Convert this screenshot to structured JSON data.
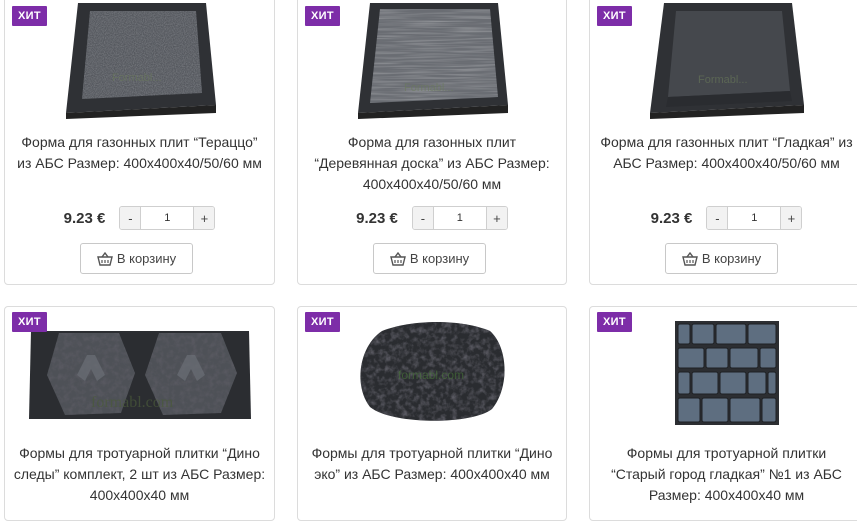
{
  "badge": "ХИТ",
  "cart_label": "В корзину",
  "products": [
    {
      "title": "Форма для газонных плит “Тераццо” из АБС Размер: 400x400x40/50/60 мм",
      "price": "9.23 €",
      "qty": "1",
      "minus": "-",
      "plus": "+",
      "watermark": "Formabl..."
    },
    {
      "title": "Форма для газонных плит “Деревянная доска” из АБС Размер: 400x400x40/50/60 мм",
      "price": "9.23 €",
      "qty": "1",
      "minus": "-",
      "plus": "+",
      "watermark": "Formabl..."
    },
    {
      "title": "Форма для газонных плит “Гладкая” из АБС Размер: 400x400x40/50/60 мм",
      "price": "9.23 €",
      "qty": "1",
      "minus": "-",
      "plus": "+",
      "watermark": "Formabl..."
    },
    {
      "title": "Формы для тротуарной плитки “Дино следы” комплект, 2 шт из АБС Размер: 400x400x40 мм",
      "watermark": "formabl.com"
    },
    {
      "title": "Формы для тротуарной плитки “Дино эко” из АБС Размер: 400x400x40 мм",
      "watermark": "formabl.com"
    },
    {
      "title": "Формы для тротуарной плитки “Старый город гладкая” №1 из АБС Размер: 400x400x40 мм"
    }
  ],
  "colors": {
    "badge": "#7d2da8",
    "mold": "#3a3c40"
  }
}
